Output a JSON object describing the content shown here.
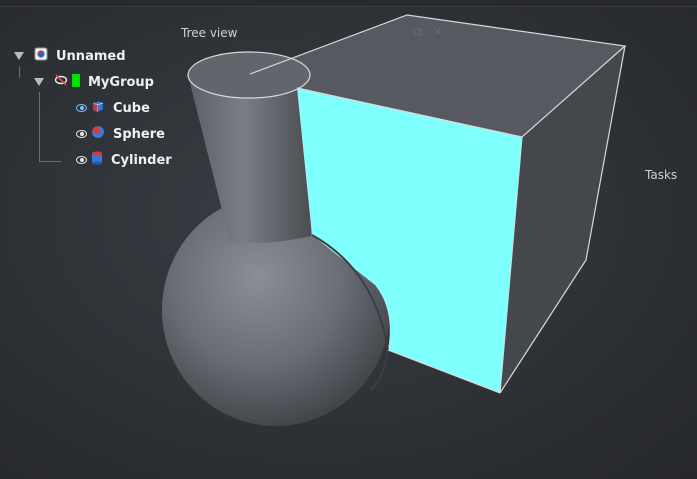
{
  "panels": {
    "tree_view_title": "Tree view",
    "tasks_title": "Tasks"
  },
  "tree": {
    "root": {
      "label": "Unnamed",
      "icon": "document-icon"
    },
    "group": {
      "label": "MyGroup",
      "icon": "group-icon",
      "color": "#00e000"
    },
    "children": [
      {
        "label": "Cube",
        "icon": "cube-icon"
      },
      {
        "label": "Sphere",
        "icon": "sphere-icon"
      },
      {
        "label": "Cylinder",
        "icon": "cylinder-icon"
      }
    ]
  },
  "colors": {
    "selected_face": "#80ffff",
    "solid": "#5a5d62",
    "edge": "#d8d8d8"
  }
}
